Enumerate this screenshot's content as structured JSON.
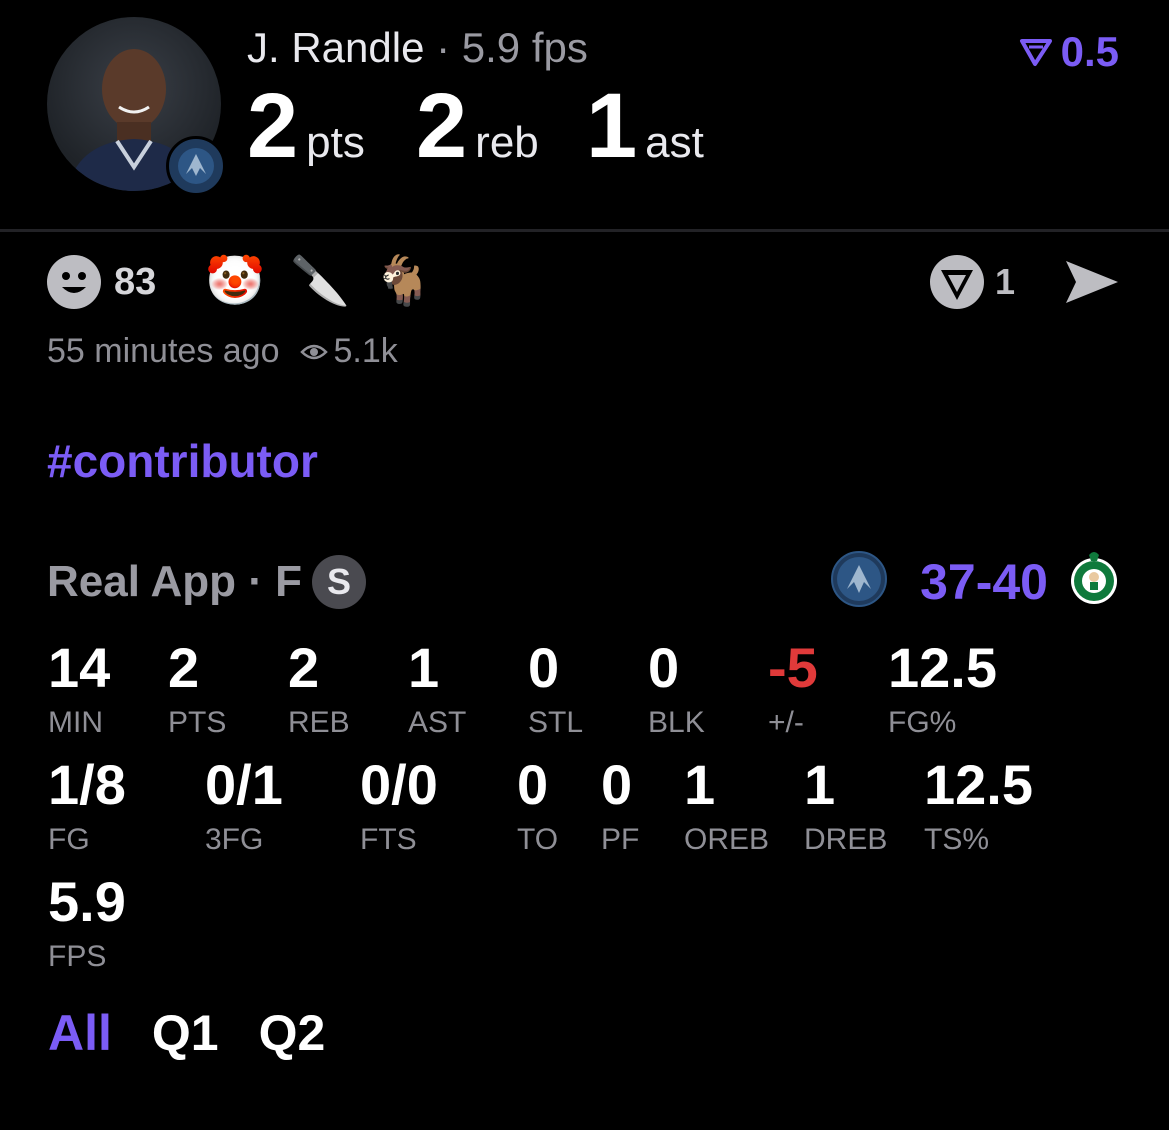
{
  "header": {
    "player_name": "J. Randle",
    "fps_label": "5.9 fps",
    "stats": [
      {
        "value": "2",
        "unit": "pts"
      },
      {
        "value": "2",
        "unit": "reb"
      },
      {
        "value": "1",
        "unit": "ast"
      }
    ],
    "line_value": "0.5",
    "team_badge_icon": "timberwolves-logo-icon"
  },
  "reactions": {
    "count": "83",
    "items": [
      "🤡",
      "🔪",
      "🐐"
    ],
    "comment_count": "1"
  },
  "meta": {
    "time": "55 minutes ago",
    "views": "5.1k"
  },
  "hashtag": "#contributor",
  "game": {
    "source": "Real App · F",
    "badge": "S",
    "score": "37-40"
  },
  "stats_row1": [
    {
      "value": "14",
      "label": "MIN"
    },
    {
      "value": "2",
      "label": "PTS"
    },
    {
      "value": "2",
      "label": "REB"
    },
    {
      "value": "1",
      "label": "AST"
    },
    {
      "value": "0",
      "label": "STL"
    },
    {
      "value": "0",
      "label": "BLK"
    },
    {
      "value": "-5",
      "label": "+/-"
    },
    {
      "value": "12.5",
      "label": "FG%"
    }
  ],
  "stats_row2": [
    {
      "value": "1/8",
      "label": "FG"
    },
    {
      "value": "0/1",
      "label": "3FG"
    },
    {
      "value": "0/0",
      "label": "FTS"
    },
    {
      "value": "0",
      "label": "TO"
    },
    {
      "value": "0",
      "label": "PF"
    },
    {
      "value": "1",
      "label": "OREB"
    },
    {
      "value": "1",
      "label": "DREB"
    },
    {
      "value": "12.5",
      "label": "TS%"
    }
  ],
  "stats_row3": [
    {
      "value": "5.9",
      "label": "FPS"
    }
  ],
  "tabs": [
    "All",
    "Q1",
    "Q2"
  ],
  "colors": {
    "accent": "#7b5cf5",
    "negative": "#e03a3a",
    "muted": "#8f8f96"
  }
}
